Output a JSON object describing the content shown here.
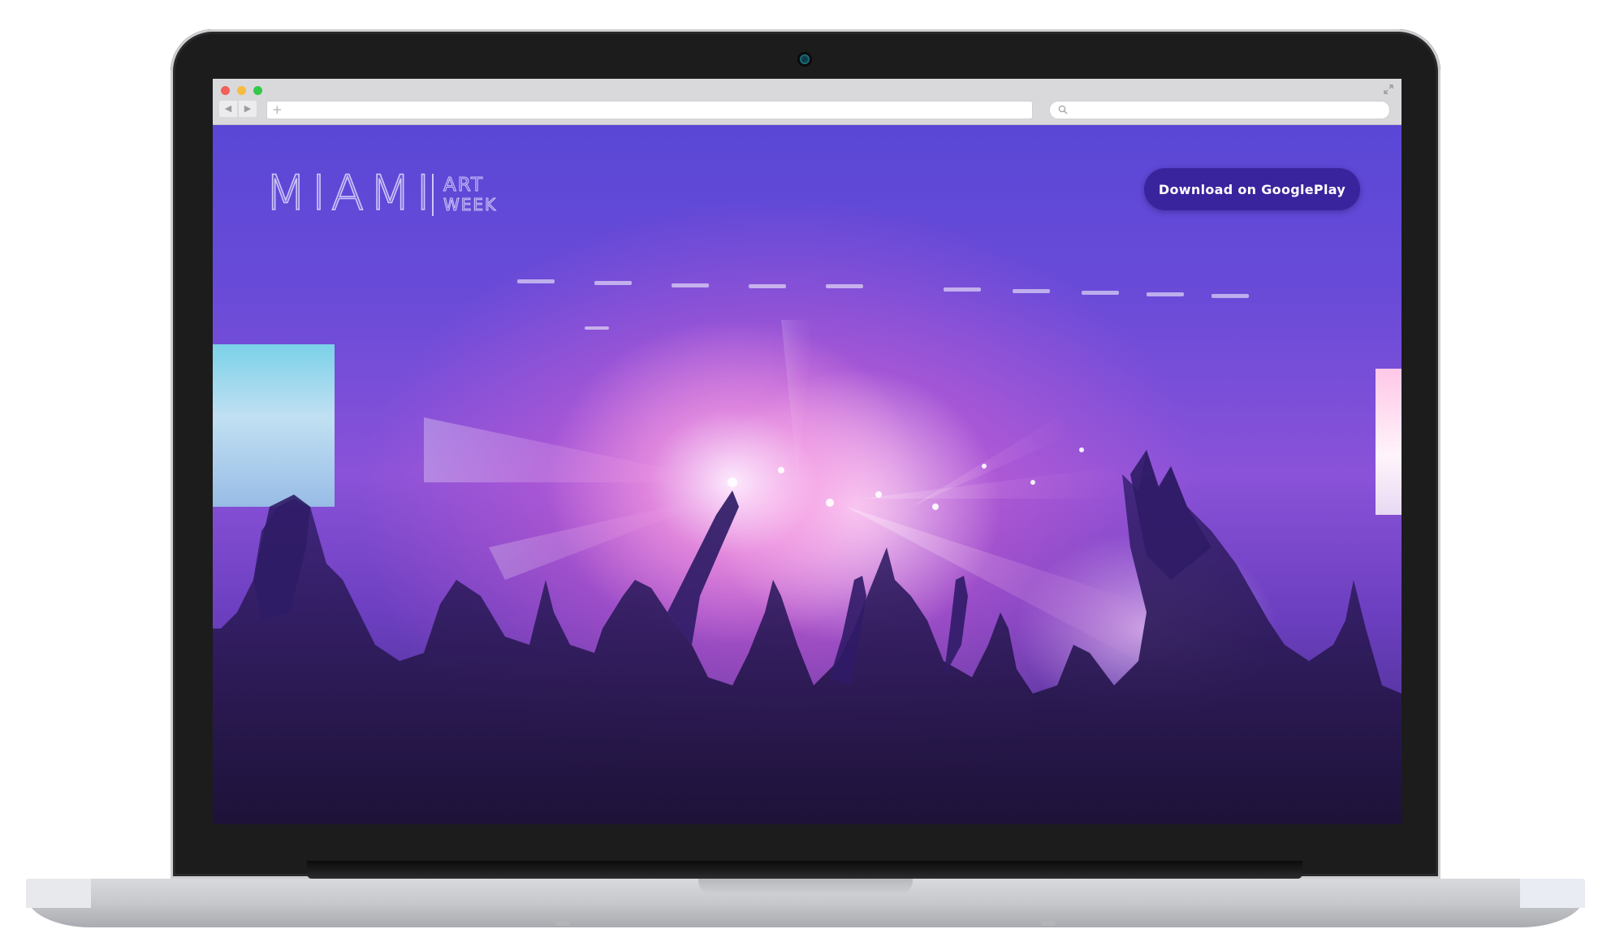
{
  "page": {
    "logo": {
      "main": "MIAMI",
      "line1": "ART",
      "line2": "WEEK"
    },
    "cta": {
      "label": "Download on GooglePlay"
    }
  },
  "browser": {
    "nav_back": "◀",
    "nav_forward": "▶",
    "new_tab": "+"
  },
  "colors": {
    "cta_background": "#3a249e",
    "browser_bar": "#d9d9db",
    "laptop_bezel": "#1c1c1d"
  },
  "icons": [
    "search-icon",
    "expand-icon",
    "plus-icon",
    "camera-icon"
  ]
}
